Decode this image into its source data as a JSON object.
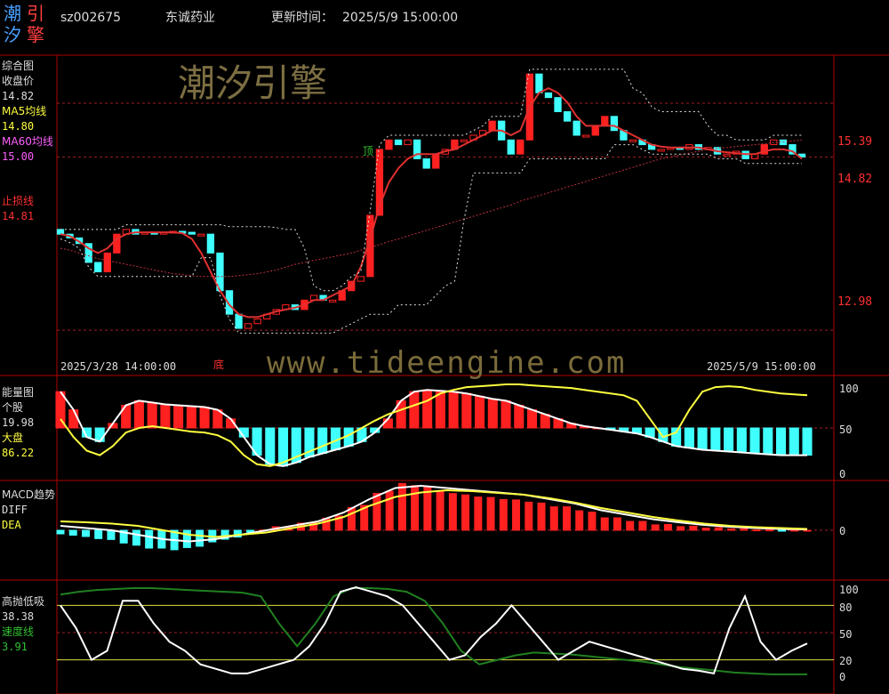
{
  "header": {
    "logo_chars": [
      "潮",
      "引",
      "汐",
      "擎"
    ],
    "stock_code": "sz002675",
    "stock_name": "东诚药业",
    "update_label": "更新时间：",
    "update_time": "2025/5/9 15:00:00"
  },
  "watermark": "潮汐引擎",
  "site_watermark": "www.tideengine.com",
  "colors": {
    "border": "#b00000",
    "up": "#ff2020",
    "down": "#40ffff",
    "ma5": "#ffffff",
    "ma60": "#e03030",
    "yellow": "#ffff40",
    "green": "#208020",
    "label": "#dddddd"
  },
  "panels": {
    "main": {
      "name": "综合图",
      "close_label": "收盘价",
      "close_value": "14.82",
      "ma5_label": "MA5均线",
      "ma5_value": "14.80",
      "ma60_label": "MA60均线",
      "ma60_value": "15.00",
      "stop_label": "止损线",
      "stop_value": "14.81",
      "top_marker": "顶",
      "bottom_marker": "底",
      "start_time": "2025/3/28 14:00:00",
      "end_time": "2025/5/9 15:00:00",
      "price_ticks": [
        "15.39",
        "14.82",
        "12.98"
      ]
    },
    "energy": {
      "name": "能量图",
      "stock_label": "个股",
      "stock_value": "19.98",
      "market_label": "大盘",
      "market_value": "86.22",
      "ticks": [
        "100",
        "50",
        "0"
      ]
    },
    "macd": {
      "name": "MACD趋势",
      "diff_label": "DIFF",
      "dea_label": "DEA",
      "ticks": [
        "0"
      ]
    },
    "osc": {
      "name": "高抛低吸",
      "value": "38.38",
      "speed_label": "速度线",
      "speed_value": "3.91",
      "ticks": [
        "100",
        "80",
        "50",
        "20",
        "0"
      ]
    }
  },
  "chart_data": [
    {
      "type": "candlestick",
      "title": "综合图",
      "ylim": [
        12.5,
        15.9
      ],
      "series": [
        {
          "name": "收盘价",
          "values": [
            14.0,
            13.96,
            13.9,
            13.7,
            13.6,
            13.8,
            14.0,
            14.05,
            14.0,
            14.02,
            14.0,
            14.02,
            14.03,
            14.02,
            14.0,
            14.0,
            13.8,
            13.4,
            13.15,
            13.0,
            13.05,
            13.1,
            13.15,
            13.2,
            13.25,
            13.2,
            13.3,
            13.35,
            13.3,
            13.3,
            13.4,
            13.5,
            13.55,
            14.2,
            14.9,
            15.0,
            14.95,
            15.0,
            14.8,
            14.7,
            14.85,
            14.9,
            15.0,
            15.0,
            15.05,
            15.1,
            15.2,
            15.0,
            14.85,
            15.0,
            15.7,
            15.5,
            15.45,
            15.3,
            15.2,
            15.05,
            15.05,
            15.15,
            15.25,
            15.1,
            15.0,
            15.0,
            14.95,
            14.9,
            14.9,
            14.92,
            14.9,
            14.95,
            14.9,
            14.92,
            14.85,
            14.85,
            14.88,
            14.8,
            14.85,
            14.95,
            15.0,
            14.95,
            14.85,
            14.82
          ]
        },
        {
          "name": "MA5均线",
          "values": [
            14.0,
            13.98,
            13.92,
            13.85,
            13.8,
            13.85,
            13.95,
            14.0,
            14.02,
            14.02,
            14.02,
            14.02,
            14.02,
            14.01,
            13.95,
            13.8,
            13.6,
            13.4,
            13.25,
            13.15,
            13.12,
            13.12,
            13.15,
            13.18,
            13.2,
            13.22,
            13.25,
            13.3,
            13.3,
            13.35,
            13.4,
            13.45,
            13.65,
            13.95,
            14.3,
            14.55,
            14.7,
            14.8,
            14.85,
            14.85,
            14.85,
            14.88,
            14.9,
            14.95,
            15.0,
            15.05,
            15.1,
            15.1,
            15.05,
            15.1,
            15.35,
            15.5,
            15.55,
            15.5,
            15.4,
            15.25,
            15.15,
            15.15,
            15.15,
            15.15,
            15.1,
            15.05,
            15.0,
            14.95,
            14.93,
            14.92,
            14.92,
            14.92,
            14.92,
            14.9,
            14.88,
            14.87,
            14.86,
            14.85,
            14.85,
            14.88,
            14.9,
            14.9,
            14.88,
            14.8
          ]
        },
        {
          "name": "MA60均线",
          "values": [
            13.85,
            13.83,
            13.8,
            13.77,
            13.74,
            13.72,
            13.7,
            13.68,
            13.66,
            13.64,
            13.62,
            13.6,
            13.58,
            13.57,
            13.56,
            13.55,
            13.55,
            13.55,
            13.55,
            13.56,
            13.57,
            13.58,
            13.6,
            13.62,
            13.65,
            13.68,
            13.7,
            13.72,
            13.74,
            13.76,
            13.78,
            13.8,
            13.83,
            13.86,
            13.89,
            13.92,
            13.95,
            13.98,
            14.01,
            14.04,
            14.07,
            14.1,
            14.13,
            14.16,
            14.19,
            14.22,
            14.25,
            14.28,
            14.31,
            14.35,
            14.38,
            14.41,
            14.44,
            14.47,
            14.5,
            14.53,
            14.56,
            14.59,
            14.62,
            14.65,
            14.68,
            14.71,
            14.74,
            14.77,
            14.8,
            14.82,
            14.84,
            14.86,
            14.88,
            14.9,
            14.91,
            14.92,
            14.93,
            14.94,
            14.95,
            14.96,
            14.97,
            14.98,
            14.99,
            15.0
          ]
        }
      ]
    },
    {
      "type": "bar",
      "title": "能量图",
      "ylim": [
        0,
        100
      ],
      "series": [
        {
          "name": "个股",
          "values": [
            90,
            70,
            40,
            35,
            55,
            75,
            80,
            78,
            76,
            75,
            74,
            73,
            70,
            60,
            40,
            20,
            10,
            8,
            12,
            18,
            22,
            26,
            30,
            35,
            45,
            60,
            80,
            90,
            92,
            91,
            90,
            88,
            85,
            82,
            80,
            75,
            70,
            65,
            60,
            55,
            52,
            50,
            48,
            46,
            44,
            40,
            35,
            30,
            28,
            26,
            25,
            24,
            23,
            22,
            21,
            20,
            20,
            20
          ]
        },
        {
          "name": "大盘",
          "values": [
            60,
            40,
            25,
            20,
            30,
            45,
            50,
            52,
            50,
            48,
            46,
            45,
            42,
            35,
            20,
            10,
            8,
            12,
            18,
            24,
            30,
            36,
            42,
            50,
            58,
            65,
            70,
            75,
            80,
            88,
            92,
            95,
            96,
            97,
            98,
            98,
            97,
            96,
            95,
            94,
            92,
            90,
            88,
            86,
            80,
            60,
            40,
            45,
            70,
            90,
            95,
            96,
            95,
            92,
            90,
            88,
            87,
            86
          ]
        }
      ]
    },
    {
      "type": "bar",
      "title": "MACD趋势",
      "series": [
        {
          "name": "DIFF",
          "values": [
            0.1,
            0.05,
            0.0,
            -0.1,
            -0.2,
            -0.25,
            -0.2,
            -0.1,
            0.0,
            0.1,
            0.2,
            0.4,
            0.7,
            0.95,
            1.0,
            0.95,
            0.9,
            0.85,
            0.8,
            0.7,
            0.6,
            0.45,
            0.35,
            0.25,
            0.18,
            0.12,
            0.08,
            0.05,
            0.03,
            0.02
          ]
        },
        {
          "name": "DEA",
          "values": [
            0.2,
            0.18,
            0.15,
            0.1,
            0.0,
            -0.1,
            -0.15,
            -0.1,
            -0.05,
            0.05,
            0.15,
            0.3,
            0.55,
            0.75,
            0.85,
            0.9,
            0.88,
            0.84,
            0.8,
            0.72,
            0.62,
            0.5,
            0.4,
            0.3,
            0.22,
            0.15,
            0.1,
            0.07,
            0.05,
            0.03
          ]
        }
      ]
    },
    {
      "type": "line",
      "title": "高抛低吸",
      "ylim": [
        0,
        100
      ],
      "series": [
        {
          "name": "高抛低吸",
          "values": [
            80,
            55,
            20,
            30,
            85,
            85,
            60,
            40,
            30,
            15,
            10,
            5,
            5,
            10,
            15,
            20,
            35,
            60,
            95,
            100,
            95,
            90,
            80,
            60,
            40,
            20,
            25,
            45,
            60,
            80,
            60,
            40,
            20,
            30,
            40,
            35,
            30,
            25,
            20,
            15,
            10,
            8,
            5,
            55,
            90,
            40,
            20,
            30,
            38
          ]
        },
        {
          "name": "速度线",
          "values": [
            92,
            95,
            97,
            98,
            99,
            99,
            98,
            97,
            96,
            95,
            94,
            90,
            60,
            35,
            60,
            90,
            99,
            99,
            98,
            95,
            85,
            60,
            30,
            15,
            20,
            25,
            28,
            27,
            26,
            24,
            22,
            20,
            18,
            15,
            12,
            10,
            8,
            6,
            5,
            4,
            4,
            4
          ]
        }
      ]
    }
  ]
}
